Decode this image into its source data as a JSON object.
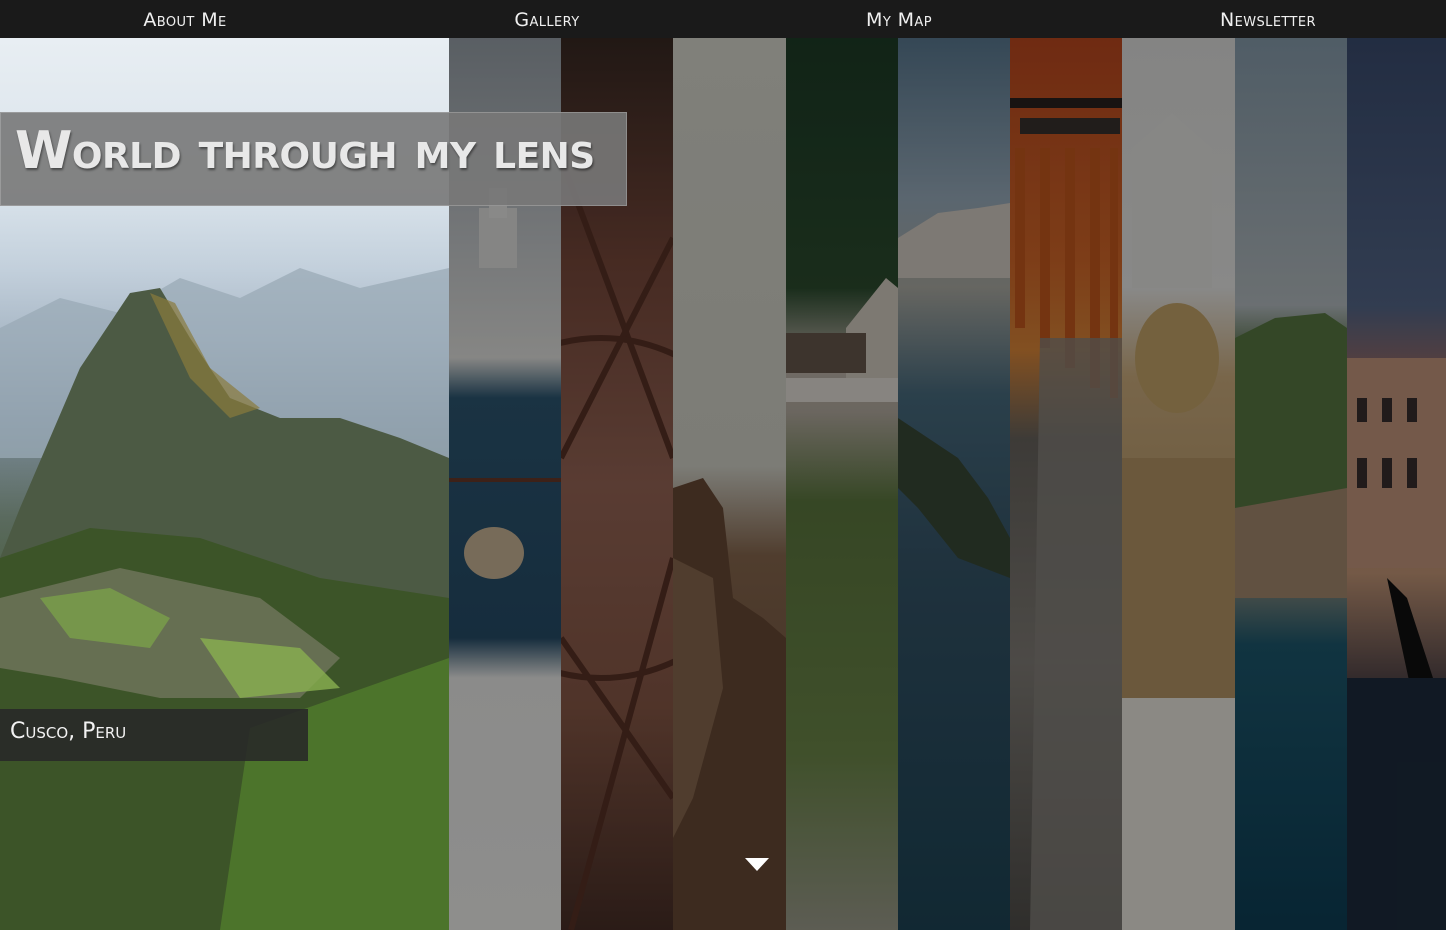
{
  "nav": {
    "items": [
      "About Me",
      "Gallery",
      "My Map",
      "Newsletter"
    ]
  },
  "hero": {
    "title": "World through my lens",
    "featured_caption": "Cusco, Peru"
  },
  "gallery": {
    "panel_count": 10,
    "featured_index": 0
  },
  "icons": {
    "scroll": "chevron-down-icon"
  },
  "colors": {
    "nav_bg": "#1a1a1a",
    "nav_text": "#f0f0f0",
    "title_bg": "#787878",
    "caption_bg": "#282828"
  }
}
